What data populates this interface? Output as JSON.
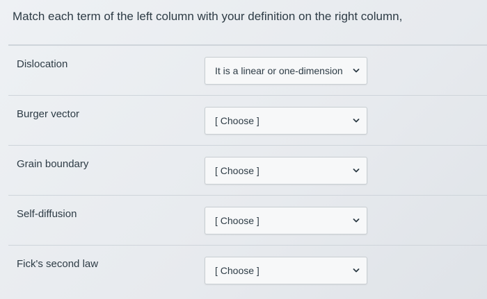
{
  "question": {
    "text": "Match each term of the left column with your definition on the right column,"
  },
  "rows": [
    {
      "term": "Dislocation",
      "answer": "It is a linear or one-dimension"
    },
    {
      "term": "Burger vector",
      "answer": "[ Choose ]"
    },
    {
      "term": "Grain boundary",
      "answer": "[ Choose ]"
    },
    {
      "term": "Self-diffusion",
      "answer": "[ Choose ]"
    },
    {
      "term": "Fick's second law",
      "answer": "[ Choose ]"
    }
  ],
  "icons": {
    "select_arrow": "chevron-down-icon"
  },
  "colors": {
    "text": "#2d3b45",
    "divider": "#ced4da",
    "select_bg": "#f7f8f9"
  }
}
